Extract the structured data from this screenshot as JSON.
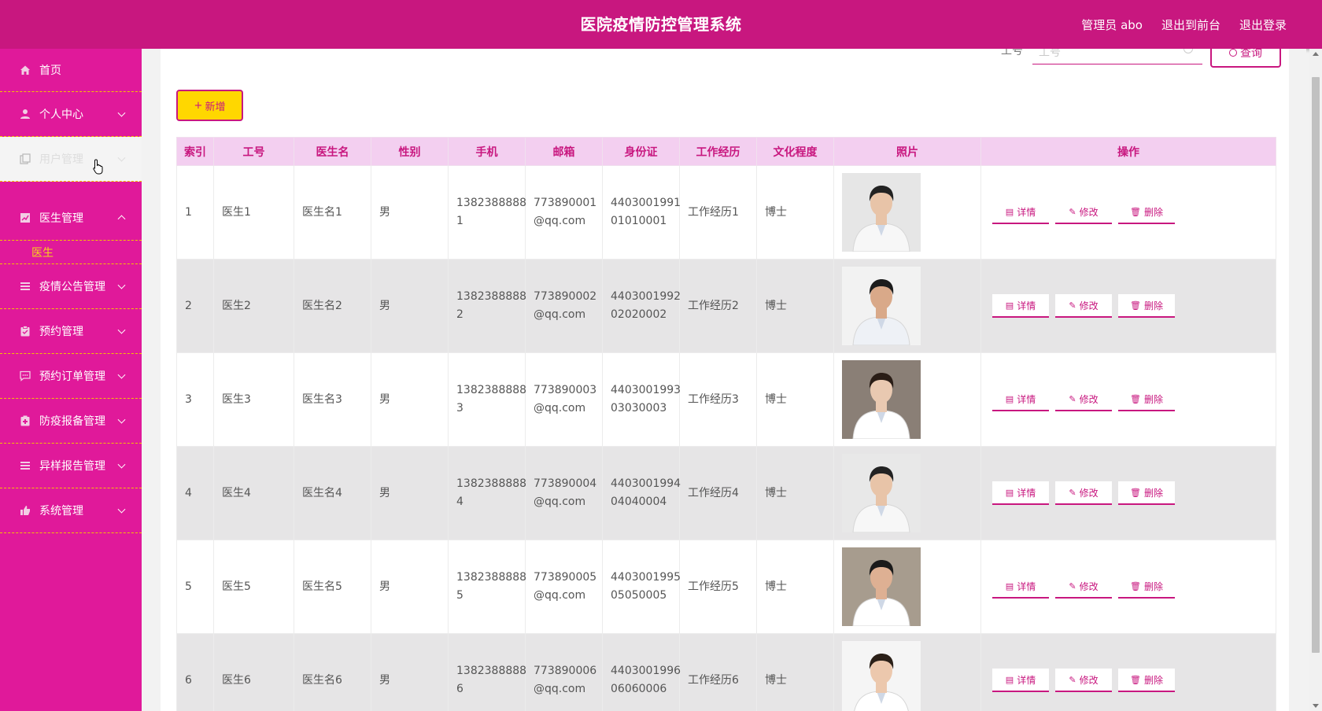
{
  "header": {
    "title": "医院疫情防控管理系统",
    "admin_label": "管理员 abo",
    "to_frontend": "退出到前台",
    "logout": "退出登录",
    "bg_color": "#c8177f"
  },
  "sidebar": {
    "bg_color": "#e0199a",
    "items": [
      {
        "label": "首页",
        "icon": "home-icon"
      },
      {
        "label": "个人中心",
        "icon": "user-icon"
      },
      {
        "label": "用户管理",
        "icon": "copy-icon"
      },
      {
        "label": "医生管理",
        "icon": "chart-icon"
      },
      {
        "label": "疫情公告管理",
        "icon": "list-icon"
      },
      {
        "label": "预约管理",
        "icon": "clipboard-icon"
      },
      {
        "label": "预约订单管理",
        "icon": "chat-icon"
      },
      {
        "label": "防疫报备管理",
        "icon": "case-icon"
      },
      {
        "label": "异样报告管理",
        "icon": "list-icon"
      },
      {
        "label": "系统管理",
        "icon": "thumb-icon"
      }
    ],
    "doctor_sub": "医生"
  },
  "search": {
    "label": "工号",
    "placeholder": "工号",
    "button": "查询"
  },
  "add_button": "新增",
  "table": {
    "headers": [
      "索引",
      "工号",
      "医生名",
      "性别",
      "手机",
      "邮箱",
      "身份证",
      "工作经历",
      "文化程度",
      "照片",
      "操作"
    ],
    "rows": [
      {
        "idx": "1",
        "id": "医生1",
        "name": "医生名1",
        "gender": "男",
        "phone1": "1382388888",
        "phone2": "1",
        "email1": "773890001",
        "email2": "@qq.com",
        "idcard1": "4403001991",
        "idcard2": "01010001",
        "exp": "工作经历1",
        "edu": "博士"
      },
      {
        "idx": "2",
        "id": "医生2",
        "name": "医生名2",
        "gender": "男",
        "phone1": "1382388888",
        "phone2": "2",
        "email1": "773890002",
        "email2": "@qq.com",
        "idcard1": "4403001992",
        "idcard2": "02020002",
        "exp": "工作经历2",
        "edu": "博士"
      },
      {
        "idx": "3",
        "id": "医生3",
        "name": "医生名3",
        "gender": "男",
        "phone1": "1382388888",
        "phone2": "3",
        "email1": "773890003",
        "email2": "@qq.com",
        "idcard1": "4403001993",
        "idcard2": "03030003",
        "exp": "工作经历3",
        "edu": "博士"
      },
      {
        "idx": "4",
        "id": "医生4",
        "name": "医生名4",
        "gender": "男",
        "phone1": "1382388888",
        "phone2": "4",
        "email1": "773890004",
        "email2": "@qq.com",
        "idcard1": "4403001994",
        "idcard2": "04040004",
        "exp": "工作经历4",
        "edu": "博士"
      },
      {
        "idx": "5",
        "id": "医生5",
        "name": "医生名5",
        "gender": "男",
        "phone1": "1382388888",
        "phone2": "5",
        "email1": "773890005",
        "email2": "@qq.com",
        "idcard1": "4403001995",
        "idcard2": "05050005",
        "exp": "工作经历5",
        "edu": "博士"
      },
      {
        "idx": "6",
        "id": "医生6",
        "name": "医生名6",
        "gender": "男",
        "phone1": "1382388888",
        "phone2": "6",
        "email1": "773890006",
        "email2": "@qq.com",
        "idcard1": "4403001996",
        "idcard2": "06060006",
        "exp": "工作经历6",
        "edu": "博士"
      }
    ],
    "ops": {
      "detail": "详情",
      "edit": "修改",
      "delete": "删除"
    }
  }
}
